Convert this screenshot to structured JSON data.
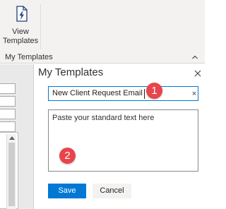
{
  "ribbon": {
    "button": {
      "label": "View\nTemplates",
      "icon": "lightning-document-icon"
    },
    "group_label": "My Templates",
    "collapse_icon": "chevron-up-icon"
  },
  "pane": {
    "title": "My Templates",
    "close_icon": "close-icon",
    "template_title_value": "New Client Request Email",
    "clear_label": "×",
    "body_placeholder": "Paste your standard text here",
    "save_label": "Save",
    "cancel_label": "Cancel"
  },
  "callouts": {
    "one": "1",
    "two": "2"
  },
  "colors": {
    "accent": "#0078d4",
    "badge": "#e8444c",
    "ribbon_bg": "#f3f2f1"
  }
}
